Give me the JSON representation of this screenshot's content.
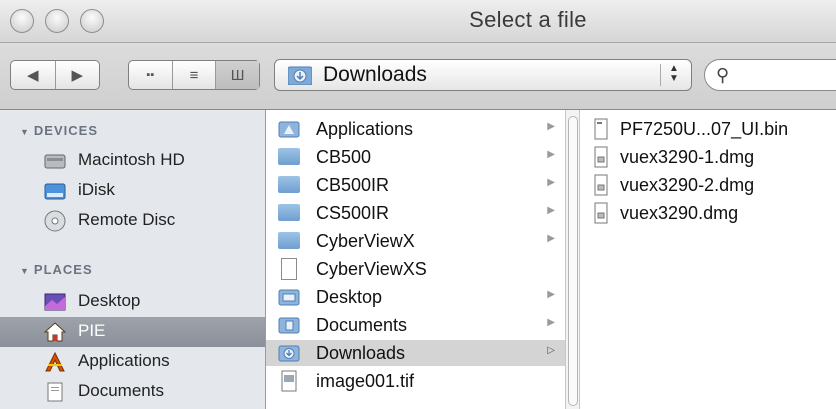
{
  "window": {
    "title": "Select a file"
  },
  "toolbar": {
    "path_popup": "Downloads",
    "search_placeholder": ""
  },
  "sidebar": {
    "devices_header": "DEVICES",
    "places_header": "PLACES",
    "devices": [
      {
        "label": "Macintosh HD",
        "icon": "hard-drive-icon"
      },
      {
        "label": "iDisk",
        "icon": "idisk-icon"
      },
      {
        "label": "Remote Disc",
        "icon": "disc-icon"
      }
    ],
    "places": [
      {
        "label": "Desktop",
        "icon": "desktop-icon"
      },
      {
        "label": "PIE",
        "icon": "home-icon",
        "selected": true
      },
      {
        "label": "Applications",
        "icon": "applications-icon"
      },
      {
        "label": "Documents",
        "icon": "documents-icon"
      }
    ]
  },
  "column1": [
    {
      "label": "Applications",
      "kind": "folder",
      "arrow": true
    },
    {
      "label": "CB500",
      "kind": "folder",
      "arrow": true
    },
    {
      "label": "CB500IR",
      "kind": "folder",
      "arrow": true
    },
    {
      "label": "CS500IR",
      "kind": "folder",
      "arrow": true
    },
    {
      "label": "CyberViewX",
      "kind": "folder",
      "arrow": true
    },
    {
      "label": "CyberViewXS",
      "kind": "file",
      "arrow": false
    },
    {
      "label": "Desktop",
      "kind": "folder",
      "arrow": true
    },
    {
      "label": "Documents",
      "kind": "folder",
      "arrow": true
    },
    {
      "label": "Downloads",
      "kind": "folder",
      "arrow": true,
      "selected": true
    },
    {
      "label": "image001.tif",
      "kind": "file",
      "arrow": false
    }
  ],
  "column2": [
    {
      "label": "PF7250U...07_UI.bin"
    },
    {
      "label": "vuex3290-1.dmg"
    },
    {
      "label": "vuex3290-2.dmg"
    },
    {
      "label": "vuex3290.dmg"
    }
  ],
  "colors": {
    "selection": "#d4d4d4",
    "sidebar_bg": "#e4e7ec",
    "folder": "#7fa9d6"
  }
}
